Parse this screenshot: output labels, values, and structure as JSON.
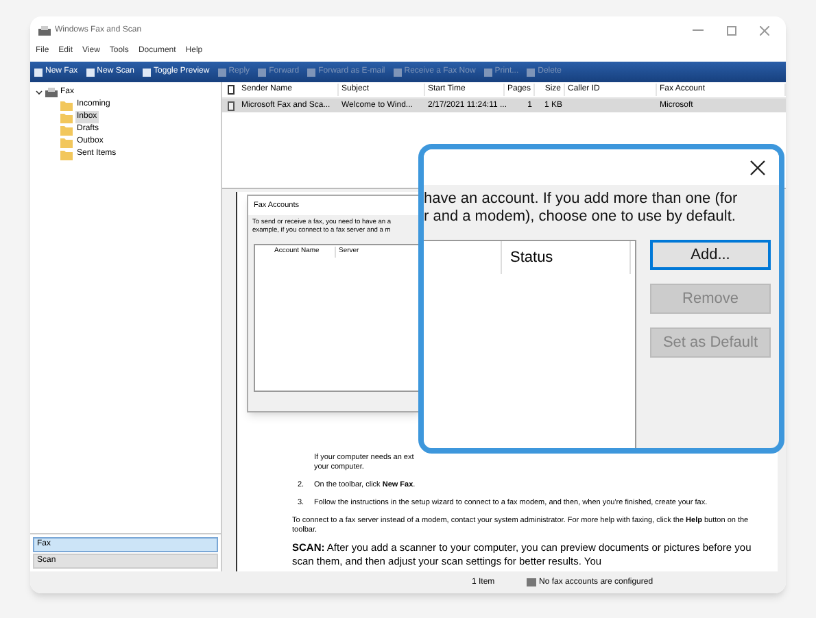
{
  "window": {
    "title": "Windows Fax and Scan"
  },
  "menu": [
    "File",
    "Edit",
    "View",
    "Tools",
    "Document",
    "Help"
  ],
  "toolbar": [
    {
      "label": "New Fax",
      "disabled": false
    },
    {
      "label": "New Scan",
      "disabled": false
    },
    {
      "label": "Toggle Preview",
      "disabled": false
    },
    {
      "label": "Reply",
      "disabled": true
    },
    {
      "label": "Forward",
      "disabled": true
    },
    {
      "label": "Forward as E-mail",
      "disabled": true
    },
    {
      "label": "Receive a Fax Now",
      "disabled": true
    },
    {
      "label": "Print...",
      "disabled": true
    },
    {
      "label": "Delete",
      "disabled": true
    }
  ],
  "tree": {
    "label": "Fax",
    "expanded": true,
    "children": [
      {
        "label": "Incoming",
        "selected": false
      },
      {
        "label": "Inbox",
        "selected": true
      },
      {
        "label": "Drafts",
        "selected": false
      },
      {
        "label": "Outbox",
        "selected": false
      },
      {
        "label": "Sent Items",
        "selected": false
      }
    ]
  },
  "nav": [
    {
      "label": "Fax",
      "selected": true
    },
    {
      "label": "Scan",
      "selected": false
    }
  ],
  "list": {
    "columns": [
      "Sender Name",
      "Subject",
      "Start Time",
      "Pages",
      "Size",
      "Caller ID",
      "Fax Account"
    ],
    "rows": [
      {
        "selected": true,
        "sender": "Microsoft Fax and Sca...",
        "subject": "Welcome to Wind...",
        "start_time": "2/17/2021 11:24:11 ...",
        "pages": "1",
        "size": "1 KB",
        "fax_account": "Microsoft"
      }
    ]
  },
  "preview": [
    {
      "kind": "text",
      "text": "If your computer needs an ext"
    },
    {
      "kind": "text",
      "text": "your computer."
    },
    {
      "kind": "step",
      "number": "2.",
      "text": "On the toolbar, click **New Fax**."
    },
    {
      "kind": "step",
      "number": "3.",
      "text": "Follow the instructions in the setup wizard to connect to a fax modem, and then, when you're finished, create your fax."
    },
    {
      "kind": "para",
      "text": "To connect to a fax server instead of a modem, contact your system administrator. For more help with faxing, click the **Help** button on the toolbar."
    },
    {
      "kind": "lead",
      "text": "**SCAN:** After you add a scanner to your computer, you can preview documents or pictures before you scan them, and then adjust your scan settings for better results. You"
    }
  ],
  "dialog": {
    "title": "Fax Accounts",
    "intro": [
      "To send or receive a fax, you need to have an a",
      "example, if you connect to a fax server and a m"
    ],
    "columns": [
      "Account Name",
      "Server"
    ]
  },
  "callout": {
    "intro": [
      "have an account. If you add more than one (for",
      "r and a modem), choose one to use by default."
    ],
    "column": "Status",
    "buttons": [
      {
        "label": "Add...",
        "focused": true,
        "disabled": false
      },
      {
        "label": "Remove",
        "focused": false,
        "disabled": true
      },
      {
        "label": "Set as Default",
        "focused": false,
        "disabled": true
      }
    ]
  },
  "status_bar": {
    "count": "1 Item",
    "message": "No fax accounts are configured"
  }
}
